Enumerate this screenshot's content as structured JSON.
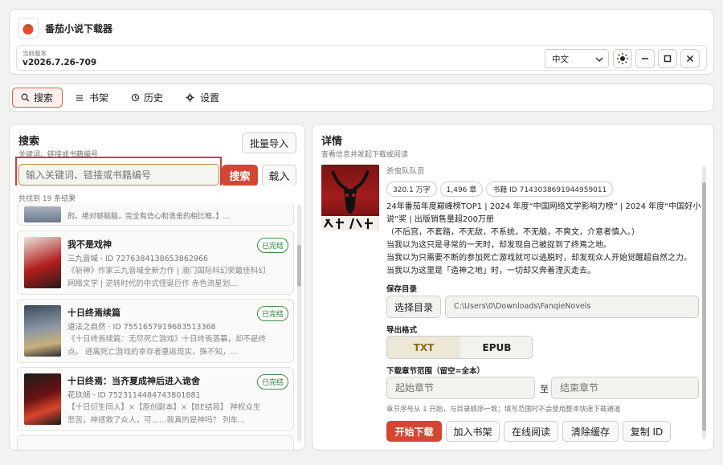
{
  "app": {
    "title": "番茄小说下载器",
    "version_label": "当前版本",
    "version": "v2026.7.26-709"
  },
  "header": {
    "language": "中文",
    "theme_icon": "sun-icon"
  },
  "nav": {
    "tabs": [
      {
        "label": "搜索",
        "icon": "search-icon",
        "active": true
      },
      {
        "label": "书架",
        "icon": "bookshelf-icon",
        "active": false
      },
      {
        "label": "历史",
        "icon": "history-icon",
        "active": false
      },
      {
        "label": "设置",
        "icon": "gear-icon",
        "active": false
      }
    ]
  },
  "search": {
    "title": "搜索",
    "subtitle": "关键词、链接或书籍编号",
    "import_label": "批量导入",
    "placeholder": "输入关键词、链接或书籍编号",
    "search_label": "搜索",
    "load_label": "载入",
    "result_count": "共找到 19 条结果",
    "partial_desc": "的。绝对够脑脑，完全有信心和诡舍的相比框。】...",
    "results": [
      {
        "title": "我不是戏神",
        "meta": "三九音域 · ID 7276384138653862966",
        "desc": "《斩神》作家三九音域全新力作 | 澳门国际科幻奖最佳科幻网络文学 | 逆转时代的中式怪诞巨作 赤色流星划...",
        "status": "已完结"
      },
      {
        "title": "十日终焉续篇",
        "meta": "道法之自然 · ID 7551657919683513368",
        "desc": "《十日终焉续篇：无尽死亡游戏》十日终焉落幕，却不是终点。 逃离死亡游戏的幸存者重返现实，殊不知，...",
        "status": "已完结"
      },
      {
        "title": "十日终焉：当齐夏成神后进入诡舍",
        "meta": "花玖倾 · ID 7523114484743801881",
        "desc": "【十日衍生同人】×【原创副本】×【BE结局】 神权众生悲苦，神拯救了众人，可……我真的是神吗？ 列车...",
        "status": "已完结"
      }
    ]
  },
  "detail": {
    "title": "详情",
    "subtitle": "查看信息并发起下载或阅读",
    "author": "杀虫队队员",
    "chips": [
      "320.1 万字",
      "1,496 章",
      "书籍 ID 7143038691944959011"
    ],
    "desc_lines": [
      "24年番茄年度巅峰榜TOP1 | 2024 年度“中国网络文学影响力榜” | 2024 年度“中国好小说”奖 | 出版销售量超200万册",
      "（不后宫，不套路，不无敌，不系统，不无脑，不爽文，介意者慎入。）",
      "当我以为这只是寻常的一天时，却发现自己被捉到了终焉之地。",
      "当我以为只需要不断的参加死亡游戏就可以逃脱时，却发现众人开始觉醒超自然之力。",
      "当我以为这里是「造神之地」时，一切却又奔着湮灭走去。"
    ],
    "save_dir_label": "保存目录",
    "choose_dir_label": "选择目录",
    "save_dir_path": "C:\\Users\\0\\Downloads\\FanqieNovels",
    "format_label": "导出格式",
    "formats": [
      "TXT",
      "EPUB"
    ],
    "range_label": "下载章节范围（留空=全本）",
    "start_placeholder": "起始章节",
    "to_label": "至",
    "end_placeholder": "结束章节",
    "range_hint": "章节序号从 1 开始，与目录顺序一致；填写范围时不会使用整本快速下载通道",
    "actions": [
      "开始下载",
      "加入书架",
      "在线阅读",
      "清除缓存",
      "复制 ID"
    ]
  },
  "colors": {
    "accent": "#d34632",
    "highlight_box": "#d63a3a",
    "done_green": "#2c7a3a"
  }
}
